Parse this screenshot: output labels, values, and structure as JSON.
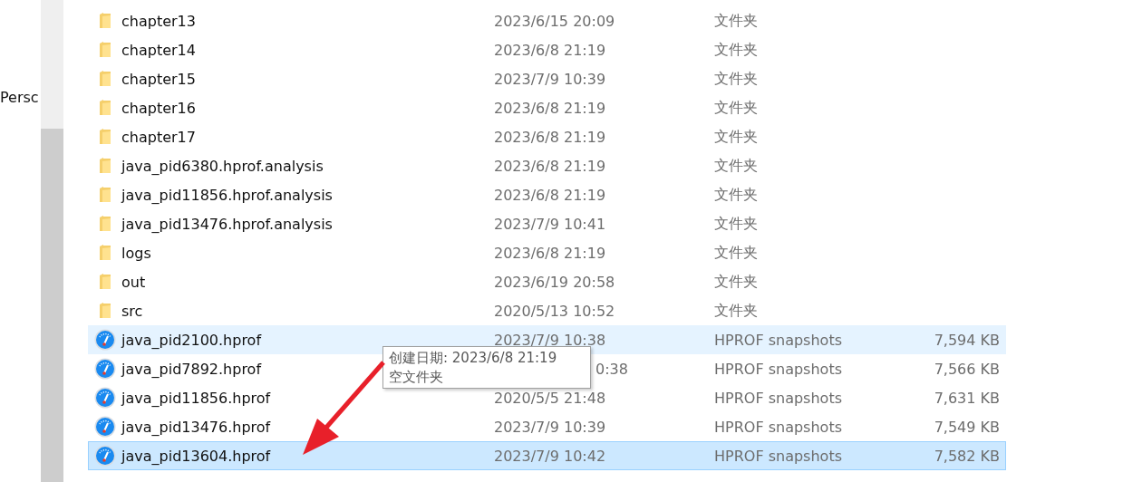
{
  "sidebar": {
    "label": "Persc"
  },
  "files": [
    {
      "kind": "folder",
      "name": "chapter13",
      "date": "2023/6/15 20:09",
      "type": "文件夹",
      "selected": false,
      "hovered": false
    },
    {
      "kind": "folder",
      "name": "chapter14",
      "date": "2023/6/8 21:19",
      "type": "文件夹",
      "selected": false,
      "hovered": false
    },
    {
      "kind": "folder",
      "name": "chapter15",
      "date": "2023/7/9 10:39",
      "type": "文件夹",
      "selected": false,
      "hovered": false
    },
    {
      "kind": "folder",
      "name": "chapter16",
      "date": "2023/6/8 21:19",
      "type": "文件夹",
      "selected": false,
      "hovered": false
    },
    {
      "kind": "folder",
      "name": "chapter17",
      "date": "2023/6/8 21:19",
      "type": "文件夹",
      "selected": false,
      "hovered": false
    },
    {
      "kind": "folder",
      "name": "java_pid6380.hprof.analysis",
      "date": "2023/6/8 21:19",
      "type": "文件夹",
      "selected": false,
      "hovered": false
    },
    {
      "kind": "folder",
      "name": "java_pid11856.hprof.analysis",
      "date": "2023/6/8 21:19",
      "type": "文件夹",
      "selected": false,
      "hovered": false
    },
    {
      "kind": "folder",
      "name": "java_pid13476.hprof.analysis",
      "date": "2023/7/9 10:41",
      "type": "文件夹",
      "selected": false,
      "hovered": false
    },
    {
      "kind": "folder",
      "name": "logs",
      "date": "2023/6/8 21:19",
      "type": "文件夹",
      "selected": false,
      "hovered": false
    },
    {
      "kind": "folder",
      "name": "out",
      "date": "2023/6/19 20:58",
      "type": "文件夹",
      "selected": false,
      "hovered": false
    },
    {
      "kind": "folder",
      "name": "src",
      "date": "2020/5/13 10:52",
      "type": "文件夹",
      "selected": false,
      "hovered": false
    },
    {
      "kind": "hprof",
      "name": "java_pid2100.hprof",
      "date": "2023/7/9 10:38",
      "type": "HPROF snapshots",
      "size": "7,594 KB",
      "selected": false,
      "hovered": true
    },
    {
      "kind": "hprof",
      "name": "java_pid7892.hprof",
      "date": "0:38",
      "date_covered": true,
      "type": "HPROF snapshots",
      "size": "7,566 KB",
      "selected": false,
      "hovered": false
    },
    {
      "kind": "hprof",
      "name": "java_pid11856.hprof",
      "date": "2020/5/5 21:48",
      "type": "HPROF snapshots",
      "size": "7,631 KB",
      "selected": false,
      "hovered": false
    },
    {
      "kind": "hprof",
      "name": "java_pid13476.hprof",
      "date": "2023/7/9 10:39",
      "type": "HPROF snapshots",
      "size": "7,549 KB",
      "selected": false,
      "hovered": false
    },
    {
      "kind": "hprof",
      "name": "java_pid13604.hprof",
      "date": "2023/7/9 10:42",
      "type": "HPROF snapshots",
      "size": "7,582 KB",
      "selected": true,
      "hovered": false
    }
  ],
  "tooltip": {
    "lines": [
      "创建日期: 2023/6/8 21:19",
      "空文件夹"
    ]
  }
}
